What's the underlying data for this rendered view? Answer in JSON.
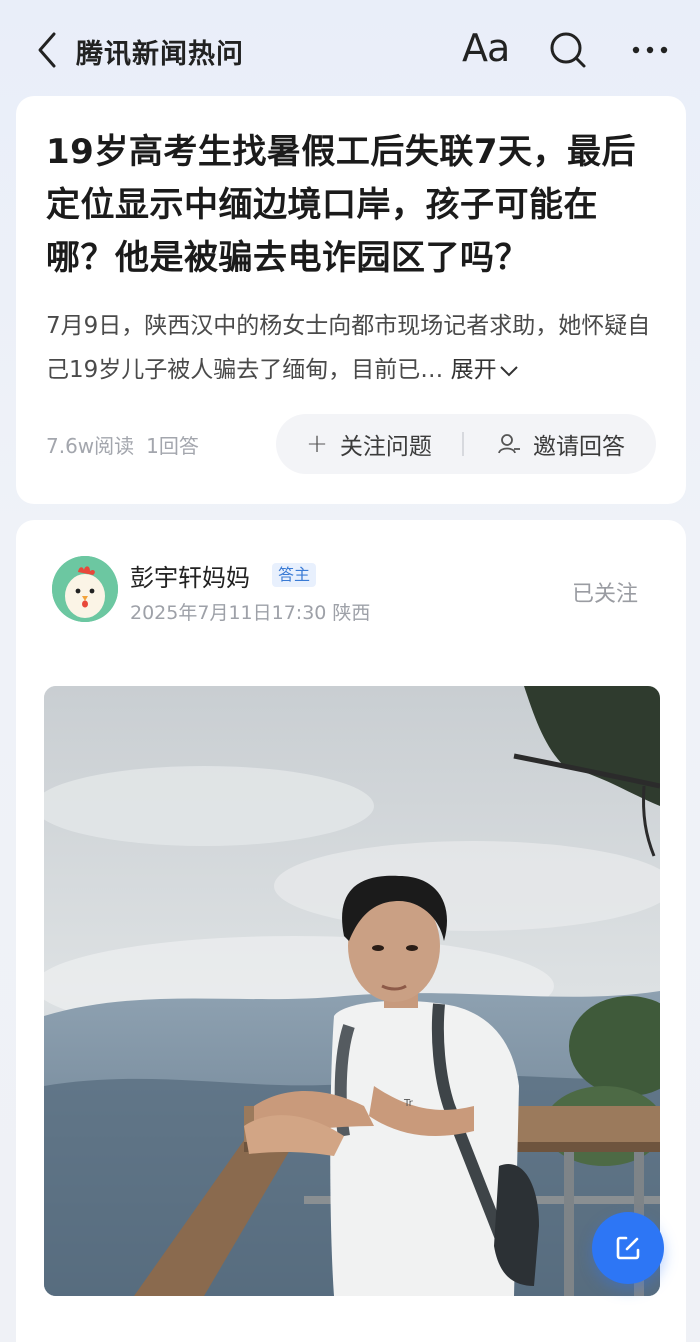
{
  "header": {
    "title": "腾讯新闻热问",
    "font_size_label": "Aa",
    "icons": [
      "back-icon",
      "font-size-icon",
      "search-icon",
      "more-icon"
    ]
  },
  "question": {
    "title": "19岁高考生找暑假工后失联7天，最后定位显示中缅边境口岸，孩子可能在哪？他是被骗去电诈园区了吗？",
    "excerpt": "7月9日，陕西汉中的杨女士向都市现场记者求助，她怀疑自己19岁儿子被人骗去了缅甸，目前已…",
    "expand_label": "展开",
    "reads": "7.6w阅读",
    "answers": "1回答",
    "follow_label": "关注问题",
    "invite_label": "邀请回答"
  },
  "answer": {
    "author_name": "彭宇轩妈妈",
    "author_badge": "答主",
    "timestamp": "2025年7月11日17:30",
    "location": "陕西",
    "follow_status": "已关注"
  },
  "colors": {
    "accent": "#2d76f5",
    "badge_text": "#3a7bd5",
    "badge_bg": "#e8f0fd",
    "page_bg": "#eef1f8"
  }
}
